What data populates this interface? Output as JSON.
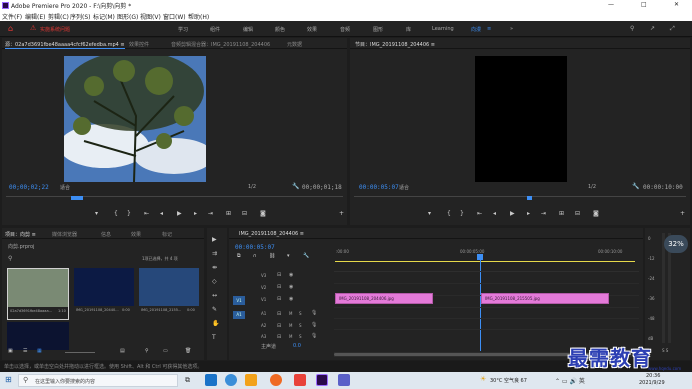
{
  "window": {
    "title": "Adobe Premiere Pro 2020 - F:\\向剪\\向剪 *",
    "controls": [
      "—",
      "□",
      "✕"
    ]
  },
  "menu": [
    "文件(F)",
    "编辑(E)",
    "剪辑(C)",
    "序列(S)",
    "标记(M)",
    "图形(G)",
    "视图(V)",
    "窗口(W)",
    "帮助(H)"
  ],
  "workspace": {
    "alert": "⚠",
    "alert_label": "实施系统问题",
    "tabs": [
      "学习",
      "组件",
      "编辑",
      "颜色",
      "效果",
      "音频",
      "图形",
      "库",
      "Learning",
      "向漫"
    ],
    "active_tab": "向漫",
    "active_marker": "≡",
    "more": "»"
  },
  "source": {
    "tabs": [
      "源：02a7d3691fbe48aaaa4cfcf62efedba.mp4 ≡",
      "效果控件",
      "音频剪辑混合器：IMG_20191108_204406",
      "元数据"
    ],
    "timecode_in": "00;00;02;22",
    "fit": "适合",
    "ratio": "1/2",
    "timecode_out": "00;00;01;18"
  },
  "program": {
    "tab": "节目：IMG_20191108_204406 ≡",
    "timecode_in": "00:00:05:07",
    "fit": "适合",
    "ratio": "1/2",
    "timecode_out": "00:00:10:00"
  },
  "project": {
    "tabs": [
      "项目：向剪 ≡",
      "媒体浏览器",
      "信息",
      "效果",
      "标记"
    ],
    "path": "向剪.prproj",
    "selection": "1项已选择，共 4 项",
    "items": [
      {
        "name": "02a7d3691fbe48aaaa...",
        "dur": "1:10"
      },
      {
        "name": "IMG_20191108_20440...",
        "dur": "0:00"
      },
      {
        "name": "IMG_20191108_2155...",
        "dur": "0:00"
      }
    ]
  },
  "timeline": {
    "tab": "IMG_20191108_204406 ≡",
    "timecode": "00:00:05:07",
    "ruler": [
      ":00:00",
      "00:00:05:00",
      "00:00:10:00"
    ],
    "video_tracks": [
      "V3",
      "V2",
      "V1"
    ],
    "audio_tracks": [
      "A1",
      "A2",
      "A3"
    ],
    "master": "主声道",
    "master_val": "0.0",
    "clips": [
      {
        "label": "IMG_20191108_204406.jpg"
      },
      {
        "label": "IMG_20191108_215505.jpg"
      }
    ]
  },
  "audio_meter": {
    "labels": [
      "0",
      "-12",
      "-24",
      "-36",
      "-48",
      "dB"
    ],
    "zoom": "32%",
    "solo": "S S"
  },
  "status": "单击以选择，或单击空白处并拖动以进行框选。使用 Shift、Alt 和 Ctrl 可获得其他选项。",
  "taskbar": {
    "search": "在这里输入你要搜索的内容",
    "weather": "30°C 空气良 67",
    "time": "20:36",
    "date": "2021/9/29"
  },
  "watermark": {
    "text": "最需教育",
    "url": "www.hqedu.com"
  },
  "colors": {
    "accent": "#3d8ff5",
    "clip": "#e47ad9",
    "alert": "#e53935",
    "yellow": "#e6d94a"
  }
}
